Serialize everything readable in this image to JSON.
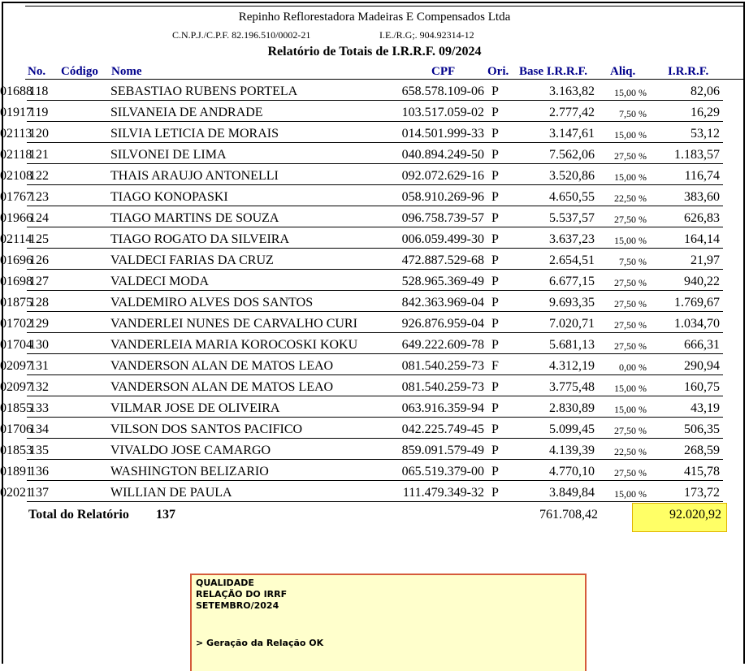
{
  "header": {
    "company": "Repinho Reflorestadora Madeiras E Compensados Ltda",
    "cnpj": "C.N.P.J./C.P.F. 82.196.510/0002-21",
    "ie": "I.E./R.G;. 904.92314-12",
    "title": "Relatório de Totais de I.R.R.F.  09/2024"
  },
  "columns": {
    "no": "No.",
    "codigo": "Código",
    "nome": "Nome",
    "cpf": "CPF",
    "ori": "Ori.",
    "base": "Base I.R.R.F.",
    "aliq": "Aliq.",
    "irrf": "I.R.R.F."
  },
  "rows": [
    {
      "no": "118",
      "codigo": "01688",
      "nome": "SEBASTIAO RUBENS PORTELA",
      "cpf": "658.578.109-06",
      "ori": "P",
      "base": "3.163,82",
      "aliq": "15,00 %",
      "irrf": "82,06"
    },
    {
      "no": "119",
      "codigo": "01917",
      "nome": "SILVANEIA DE ANDRADE",
      "cpf": "103.517.059-02",
      "ori": "P",
      "base": "2.777,42",
      "aliq": "7,50 %",
      "irrf": "16,29"
    },
    {
      "no": "120",
      "codigo": "02113",
      "nome": "SILVIA LETICIA DE MORAIS",
      "cpf": "014.501.999-33",
      "ori": "P",
      "base": "3.147,61",
      "aliq": "15,00 %",
      "irrf": "53,12"
    },
    {
      "no": "121",
      "codigo": "02118",
      "nome": "SILVONEI DE LIMA",
      "cpf": "040.894.249-50",
      "ori": "P",
      "base": "7.562,06",
      "aliq": "27,50 %",
      "irrf": "1.183,57"
    },
    {
      "no": "122",
      "codigo": "02108",
      "nome": "THAIS ARAUJO ANTONELLI",
      "cpf": "092.072.629-16",
      "ori": "P",
      "base": "3.520,86",
      "aliq": "15,00 %",
      "irrf": "116,74"
    },
    {
      "no": "123",
      "codigo": "01767",
      "nome": "TIAGO KONOPASKI",
      "cpf": "058.910.269-96",
      "ori": "P",
      "base": "4.650,55",
      "aliq": "22,50 %",
      "irrf": "383,60"
    },
    {
      "no": "124",
      "codigo": "01966",
      "nome": "TIAGO MARTINS DE SOUZA",
      "cpf": "096.758.739-57",
      "ori": "P",
      "base": "5.537,57",
      "aliq": "27,50 %",
      "irrf": "626,83"
    },
    {
      "no": "125",
      "codigo": "02114",
      "nome": "TIAGO ROGATO DA SILVEIRA",
      "cpf": "006.059.499-30",
      "ori": "P",
      "base": "3.637,23",
      "aliq": "15,00 %",
      "irrf": "164,14"
    },
    {
      "no": "126",
      "codigo": "01696",
      "nome": "VALDECI FARIAS DA CRUZ",
      "cpf": "472.887.529-68",
      "ori": "P",
      "base": "2.654,51",
      "aliq": "7,50 %",
      "irrf": "21,97"
    },
    {
      "no": "127",
      "codigo": "01698",
      "nome": "VALDECI MODA",
      "cpf": "528.965.369-49",
      "ori": "P",
      "base": "6.677,15",
      "aliq": "27,50 %",
      "irrf": "940,22"
    },
    {
      "no": "128",
      "codigo": "01875",
      "nome": "VALDEMIRO ALVES DOS SANTOS",
      "cpf": "842.363.969-04",
      "ori": "P",
      "base": "9.693,35",
      "aliq": "27,50 %",
      "irrf": "1.769,67"
    },
    {
      "no": "129",
      "codigo": "01702",
      "nome": "VANDERLEI NUNES DE CARVALHO CURI",
      "cpf": "926.876.959-04",
      "ori": "P",
      "base": "7.020,71",
      "aliq": "27,50 %",
      "irrf": "1.034,70"
    },
    {
      "no": "130",
      "codigo": "01704",
      "nome": "VANDERLEIA MARIA KOROCOSKI KOKU",
      "cpf": "649.222.609-78",
      "ori": "P",
      "base": "5.681,13",
      "aliq": "27,50 %",
      "irrf": "666,31"
    },
    {
      "no": "131",
      "codigo": "02097",
      "nome": "VANDERSON ALAN DE MATOS LEAO",
      "cpf": "081.540.259-73",
      "ori": "F",
      "base": "4.312,19",
      "aliq": "0,00 %",
      "irrf": "290,94"
    },
    {
      "no": "132",
      "codigo": "02097",
      "nome": "VANDERSON ALAN DE MATOS LEAO",
      "cpf": "081.540.259-73",
      "ori": "P",
      "base": "3.775,48",
      "aliq": "15,00 %",
      "irrf": "160,75"
    },
    {
      "no": "133",
      "codigo": "01855",
      "nome": "VILMAR JOSE DE OLIVEIRA",
      "cpf": "063.916.359-94",
      "ori": "P",
      "base": "2.830,89",
      "aliq": "15,00 %",
      "irrf": "43,19"
    },
    {
      "no": "134",
      "codigo": "01706",
      "nome": "VILSON DOS SANTOS PACIFICO",
      "cpf": "042.225.749-45",
      "ori": "P",
      "base": "5.099,45",
      "aliq": "27,50 %",
      "irrf": "506,35"
    },
    {
      "no": "135",
      "codigo": "01853",
      "nome": "VIVALDO JOSE CAMARGO",
      "cpf": "859.091.579-49",
      "ori": "P",
      "base": "4.139,39",
      "aliq": "22,50 %",
      "irrf": "268,59"
    },
    {
      "no": "136",
      "codigo": "01891",
      "nome": "WASHINGTON BELIZARIO",
      "cpf": "065.519.379-00",
      "ori": "P",
      "base": "4.770,10",
      "aliq": "27,50 %",
      "irrf": "415,78"
    },
    {
      "no": "137",
      "codigo": "02021",
      "nome": "WILLIAN DE PAULA",
      "cpf": "111.479.349-32",
      "ori": "P",
      "base": "3.849,84",
      "aliq": "15,00 %",
      "irrf": "173,72"
    }
  ],
  "totals": {
    "label": "Total do Relatório",
    "count": "137",
    "base": "761.708,42",
    "irrf": "92.020,92",
    "highlight_color": "#ffff66"
  },
  "note": {
    "lines": [
      "QUALIDADE",
      "RELAÇÃO DO IRRF",
      "SETEMBRO/2024",
      "> Geração da Relação OK"
    ],
    "background": "#ffffcc",
    "border_color": "#d55b3b"
  }
}
